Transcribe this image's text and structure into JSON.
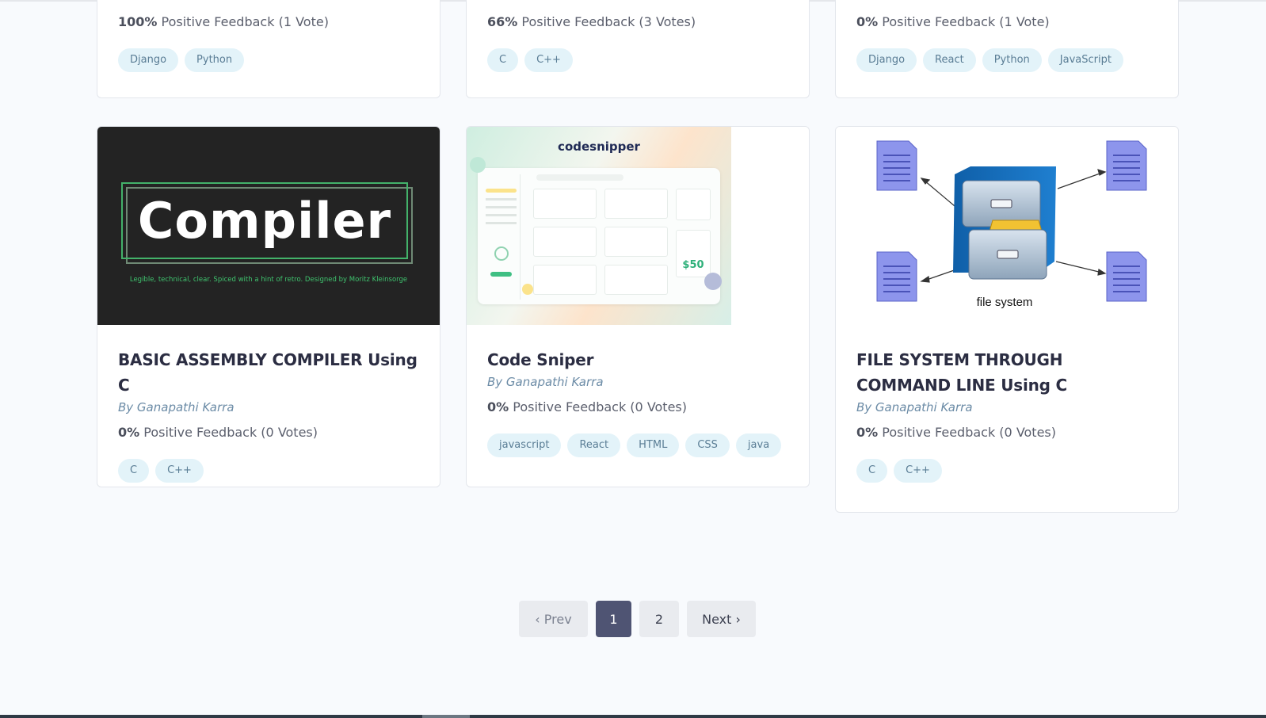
{
  "top_cards": [
    {
      "pct": "100%",
      "feedback_rest": " Positive Feedback (1 Vote)",
      "tags": [
        "Django",
        "Python"
      ]
    },
    {
      "pct": "66%",
      "feedback_rest": " Positive Feedback (3 Votes)",
      "tags": [
        "C",
        "C++"
      ]
    },
    {
      "pct": "0%",
      "feedback_rest": " Positive Feedback (1 Vote)",
      "tags": [
        "Django",
        "React",
        "Python",
        "JavaScript"
      ]
    }
  ],
  "cards": [
    {
      "title": "BASIC ASSEMBLY COMPILER Using C",
      "author": "By Ganapathi Karra",
      "pct": "0%",
      "feedback_rest": " Positive Feedback (0 Votes)",
      "tags": [
        "C",
        "C++"
      ],
      "thumb": {
        "word": "Compiler",
        "tagline": "Legible, technical, clear. Spiced with a hint of retro. Designed by Moritz Kleinsorge"
      }
    },
    {
      "title": "Code Sniper",
      "author": "By Ganapathi Karra",
      "pct": "0%",
      "feedback_rest": " Positive Feedback (0 Votes)",
      "tags": [
        "javascript",
        "React",
        "HTML",
        "CSS",
        "java"
      ],
      "thumb": {
        "brand": "codesnipper",
        "price": "$50"
      }
    },
    {
      "title": "FILE SYSTEM THROUGH COMMAND LINE Using C",
      "author": "By Ganapathi Karra",
      "pct": "0%",
      "feedback_rest": " Positive Feedback (0 Votes)",
      "tags": [
        "C",
        "C++"
      ],
      "thumb": {
        "caption": "file system"
      }
    }
  ],
  "pagination": {
    "prev": "‹ Prev",
    "page1": "1",
    "page2": "2",
    "next": "Next ›",
    "current": 1
  },
  "colors": {
    "accent": "#4f5473",
    "tag_bg": "#e3f3f9",
    "author": "#6b8ba6"
  }
}
